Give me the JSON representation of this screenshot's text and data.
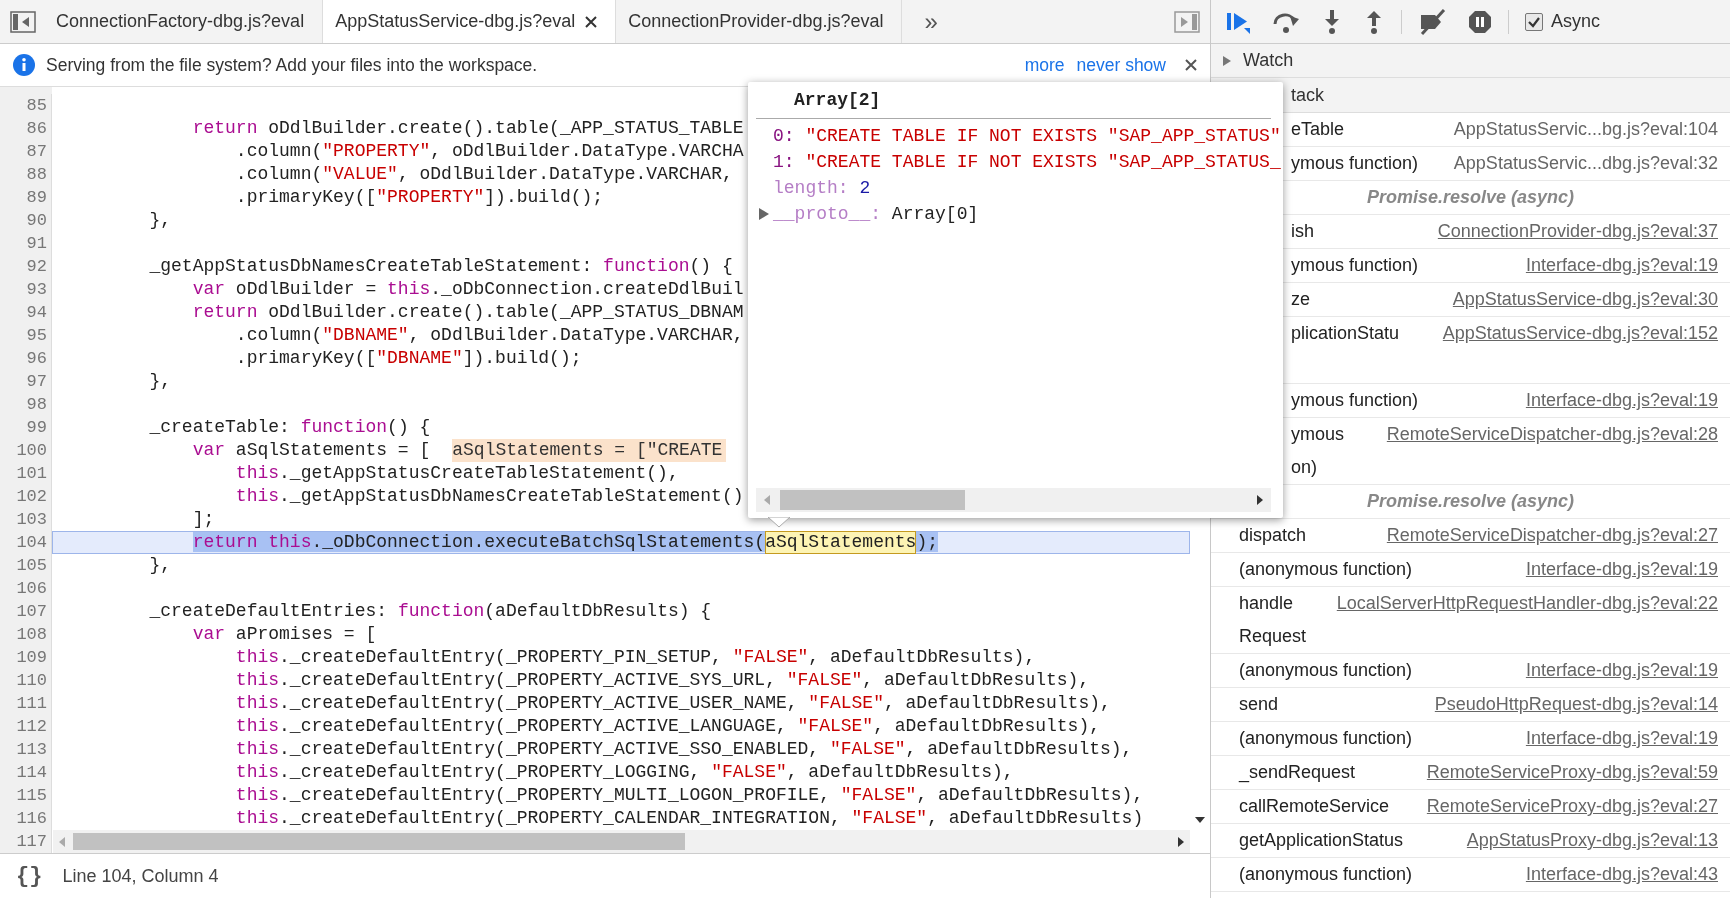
{
  "tabs": [
    {
      "label": "ConnectionFactory-dbg.js?eval",
      "selected": false
    },
    {
      "label": "AppStatusService-dbg.js?eval",
      "selected": true
    },
    {
      "label": "ConnectionProvider-dbg.js?eval",
      "selected": false
    }
  ],
  "tab_overflow": "»",
  "infobar": {
    "message": "Serving from the file system? Add your files into the workspace.",
    "links": [
      "more",
      "never show"
    ]
  },
  "code": {
    "lines": [
      {
        "number": "85",
        "current": false
      },
      {
        "number": "86",
        "current": false,
        "tokens": [
          {
            "text": "            return",
            "kind": "keyword"
          },
          {
            "text": " oDdlBuilder.create().table(_APP_STATUS_TABLE",
            "kind": "plain"
          }
        ]
      },
      {
        "number": "87",
        "current": false,
        "tokens": [
          {
            "text": "                .column(",
            "kind": "plain"
          },
          {
            "text": "\"PROPERTY\"",
            "kind": "string"
          },
          {
            "text": ", oDdlBuilder.DataType.VARCHA",
            "kind": "plain"
          }
        ]
      },
      {
        "number": "88",
        "current": false,
        "tokens": [
          {
            "text": "                .column(",
            "kind": "plain"
          },
          {
            "text": "\"VALUE\"",
            "kind": "string"
          },
          {
            "text": ", oDdlBuilder.DataType.VARCHAR,",
            "kind": "plain"
          }
        ]
      },
      {
        "number": "89",
        "current": false,
        "tokens": [
          {
            "text": "                .primaryKey([",
            "kind": "plain"
          },
          {
            "text": "\"PROPERTY\"",
            "kind": "string"
          },
          {
            "text": "]).build();",
            "kind": "plain"
          }
        ]
      },
      {
        "number": "90",
        "current": false,
        "tokens": [
          {
            "text": "        },",
            "kind": "plain"
          }
        ]
      },
      {
        "number": "91",
        "current": false
      },
      {
        "number": "92",
        "current": false,
        "tokens": [
          {
            "text": "        _getAppStatusDbNamesCreateTableStatement: ",
            "kind": "plain"
          },
          {
            "text": "function",
            "kind": "keyword"
          },
          {
            "text": "() {",
            "kind": "plain"
          }
        ]
      },
      {
        "number": "93",
        "current": false,
        "tokens": [
          {
            "text": "            var",
            "kind": "keyword"
          },
          {
            "text": " oDdlBuilder = ",
            "kind": "plain"
          },
          {
            "text": "this",
            "kind": "keyword"
          },
          {
            "text": "._oDbConnection.createDdlBuil",
            "kind": "plain"
          }
        ]
      },
      {
        "number": "94",
        "current": false,
        "tokens": [
          {
            "text": "            return",
            "kind": "keyword"
          },
          {
            "text": " oDdlBuilder.create().table(_APP_STATUS_DBNAM",
            "kind": "plain"
          }
        ]
      },
      {
        "number": "95",
        "current": false,
        "tokens": [
          {
            "text": "                .column(",
            "kind": "plain"
          },
          {
            "text": "\"DBNAME\"",
            "kind": "string"
          },
          {
            "text": ", oDdlBuilder.DataType.VARCHAR,",
            "kind": "plain"
          }
        ]
      },
      {
        "number": "96",
        "current": false,
        "tokens": [
          {
            "text": "                .primaryKey([",
            "kind": "plain"
          },
          {
            "text": "\"DBNAME\"",
            "kind": "string"
          },
          {
            "text": "]).build();",
            "kind": "plain"
          }
        ]
      },
      {
        "number": "97",
        "current": false,
        "tokens": [
          {
            "text": "        },",
            "kind": "plain"
          }
        ]
      },
      {
        "number": "98",
        "current": false
      },
      {
        "number": "99",
        "current": false,
        "tokens": [
          {
            "text": "        _createTable: ",
            "kind": "plain"
          },
          {
            "text": "function",
            "kind": "keyword"
          },
          {
            "text": "() {",
            "kind": "plain"
          }
        ]
      },
      {
        "number": "100",
        "current": false,
        "tokens": [
          {
            "text": "            var",
            "kind": "keyword"
          },
          {
            "text": " aSqlStatements = [",
            "kind": "plain"
          },
          {
            "text": "aSqlStatements = [\"CREATE",
            "kind": "inline-value"
          }
        ]
      },
      {
        "number": "101",
        "current": false,
        "tokens": [
          {
            "text": "                this",
            "kind": "keyword"
          },
          {
            "text": "._getAppStatusCreateTableStatement(),",
            "kind": "plain"
          }
        ]
      },
      {
        "number": "102",
        "current": false,
        "tokens": [
          {
            "text": "                this",
            "kind": "keyword"
          },
          {
            "text": "._getAppStatusDbNamesCreateTableStatement()",
            "kind": "plain"
          }
        ]
      },
      {
        "number": "103",
        "current": false,
        "tokens": [
          {
            "text": "            ];",
            "kind": "plain"
          }
        ]
      },
      {
        "number": "104",
        "current": true,
        "tokens": [
          {
            "text": "            return",
            "kind": "keyword"
          },
          {
            "text": " this",
            "kind": "keyword"
          },
          {
            "text": "._oDbConnection.executeBatchSqlStatements(",
            "kind": "plain"
          },
          {
            "text": "aSqlStatements",
            "kind": "hover-value"
          },
          {
            "text": ");",
            "kind": "plain"
          }
        ]
      },
      {
        "number": "105",
        "current": false,
        "tokens": [
          {
            "text": "        },",
            "kind": "plain"
          }
        ]
      },
      {
        "number": "106",
        "current": false
      },
      {
        "number": "107",
        "current": false,
        "tokens": [
          {
            "text": "        _createDefaultEntries: ",
            "kind": "plain"
          },
          {
            "text": "function",
            "kind": "keyword"
          },
          {
            "text": "(aDefaultDbResults) {",
            "kind": "plain"
          }
        ]
      },
      {
        "number": "108",
        "current": false,
        "tokens": [
          {
            "text": "            var",
            "kind": "keyword"
          },
          {
            "text": " aPromises = [",
            "kind": "plain"
          }
        ]
      },
      {
        "number": "109",
        "current": false,
        "tokens": [
          {
            "text": "                this",
            "kind": "keyword"
          },
          {
            "text": "._createDefaultEntry(_PROPERTY_PIN_SETUP, ",
            "kind": "plain"
          },
          {
            "text": "\"FALSE\"",
            "kind": "string"
          },
          {
            "text": ", aDefaultDbResults),",
            "kind": "plain"
          }
        ]
      },
      {
        "number": "110",
        "current": false,
        "tokens": [
          {
            "text": "                this",
            "kind": "keyword"
          },
          {
            "text": "._createDefaultEntry(_PROPERTY_ACTIVE_SYS_URL, ",
            "kind": "plain"
          },
          {
            "text": "\"FALSE\"",
            "kind": "string"
          },
          {
            "text": ", aDefaultDbResults),",
            "kind": "plain"
          }
        ]
      },
      {
        "number": "111",
        "current": false,
        "tokens": [
          {
            "text": "                this",
            "kind": "keyword"
          },
          {
            "text": "._createDefaultEntry(_PROPERTY_ACTIVE_USER_NAME, ",
            "kind": "plain"
          },
          {
            "text": "\"FALSE\"",
            "kind": "string"
          },
          {
            "text": ", aDefaultDbResults),",
            "kind": "plain"
          }
        ]
      },
      {
        "number": "112",
        "current": false,
        "tokens": [
          {
            "text": "                this",
            "kind": "keyword"
          },
          {
            "text": "._createDefaultEntry(_PROPERTY_ACTIVE_LANGUAGE, ",
            "kind": "plain"
          },
          {
            "text": "\"FALSE\"",
            "kind": "string"
          },
          {
            "text": ", aDefaultDbResults),",
            "kind": "plain"
          }
        ]
      },
      {
        "number": "113",
        "current": false,
        "tokens": [
          {
            "text": "                this",
            "kind": "keyword"
          },
          {
            "text": "._createDefaultEntry(_PROPERTY_ACTIVE_SSO_ENABLED, ",
            "kind": "plain"
          },
          {
            "text": "\"FALSE\"",
            "kind": "string"
          },
          {
            "text": ", aDefaultDbResults),",
            "kind": "plain"
          }
        ]
      },
      {
        "number": "114",
        "current": false,
        "tokens": [
          {
            "text": "                this",
            "kind": "keyword"
          },
          {
            "text": "._createDefaultEntry(_PROPERTY_LOGGING, ",
            "kind": "plain"
          },
          {
            "text": "\"FALSE\"",
            "kind": "string"
          },
          {
            "text": ", aDefaultDbResults),",
            "kind": "plain"
          }
        ]
      },
      {
        "number": "115",
        "current": false,
        "tokens": [
          {
            "text": "                this",
            "kind": "keyword"
          },
          {
            "text": "._createDefaultEntry(_PROPERTY_MULTI_LOGON_PROFILE, ",
            "kind": "plain"
          },
          {
            "text": "\"FALSE\"",
            "kind": "string"
          },
          {
            "text": ", aDefaultDbResults),",
            "kind": "plain"
          }
        ]
      },
      {
        "number": "116",
        "current": false,
        "tokens": [
          {
            "text": "                this",
            "kind": "keyword"
          },
          {
            "text": "._createDefaultEntry(_PROPERTY_CALENDAR_INTEGRATION, ",
            "kind": "plain"
          },
          {
            "text": "\"FALSE\"",
            "kind": "string"
          },
          {
            "text": ", aDefaultDbResults)",
            "kind": "plain"
          }
        ]
      },
      {
        "number": "117",
        "current": false
      }
    ]
  },
  "popover": {
    "title": "Array[2]",
    "properties": [
      {
        "key": "0:",
        "value": "\"CREATE TABLE IF NOT EXISTS \"SAP_APP_STATUS\"",
        "kind": "string",
        "enumerable": true
      },
      {
        "key": "1:",
        "value": "\"CREATE TABLE IF NOT EXISTS \"SAP_APP_STATUS_",
        "kind": "string",
        "enumerable": true
      },
      {
        "key": "length:",
        "value": "2",
        "kind": "number",
        "enumerable": false
      },
      {
        "key": "__proto__:",
        "value": "Array[0]",
        "kind": "object",
        "enumerable": false
      }
    ]
  },
  "status_bar": {
    "format_button": "{}",
    "position": "Line 104, Column 4"
  },
  "debugger": {
    "async": {
      "label": "Async",
      "checked": true
    },
    "watch": {
      "title": "Watch",
      "expanded": false
    },
    "call_stack": {
      "title": "tack",
      "frames": [
        {
          "kind": "frame",
          "name": [
            "eTable"
          ],
          "location": "AppStatusServic...bg.js?eval:104",
          "linked": false
        },
        {
          "kind": "frame",
          "name": [
            "ymous function)"
          ],
          "location": "AppStatusServic...dbg.js?eval:32",
          "linked": false
        },
        {
          "kind": "async",
          "name": [
            "Promise.resolve (async)"
          ]
        },
        {
          "kind": "frame",
          "name": [
            "ish"
          ],
          "location": "ConnectionProvider-dbg.js?eval:37",
          "linked": true
        },
        {
          "kind": "frame",
          "name": [
            "ymous function)"
          ],
          "location": "Interface-dbg.js?eval:19",
          "linked": true
        },
        {
          "kind": "frame",
          "name": [
            "ze"
          ],
          "location": "AppStatusService-dbg.js?eval:30",
          "linked": true
        },
        {
          "kind": "frame",
          "name": [
            "plicationStatu"
          ],
          "location": "AppStatusService-dbg.js?eval:152",
          "linked": true
        },
        {
          "kind": "frame",
          "name": [
            "ymous function)"
          ],
          "location": "Interface-dbg.js?eval:19",
          "linked": true
        },
        {
          "kind": "frame",
          "name": [
            "ymous",
            "on)"
          ],
          "location": "RemoteServiceDispatcher-dbg.js?eval:28",
          "linked": true
        },
        {
          "kind": "async",
          "name": [
            "Promise.resolve (async)"
          ]
        },
        {
          "kind": "frame",
          "name": [
            "dispatch"
          ],
          "location": "RemoteServiceDispatcher-dbg.js?eval:27",
          "linked": true
        },
        {
          "kind": "frame",
          "name": [
            "(anonymous function)"
          ],
          "location": "Interface-dbg.js?eval:19",
          "linked": true
        },
        {
          "kind": "frame",
          "name": [
            "handle",
            "Request"
          ],
          "location": "LocalServerHttpRequestHandler-dbg.js?eval:22",
          "linked": true
        },
        {
          "kind": "frame",
          "name": [
            "(anonymous function)"
          ],
          "location": "Interface-dbg.js?eval:19",
          "linked": true
        },
        {
          "kind": "frame",
          "name": [
            "send"
          ],
          "location": "PseudoHttpRequest-dbg.js?eval:14",
          "linked": true
        },
        {
          "kind": "frame",
          "name": [
            "(anonymous function)"
          ],
          "location": "Interface-dbg.js?eval:19",
          "linked": true
        },
        {
          "kind": "frame",
          "name": [
            "_sendRequest"
          ],
          "location": "RemoteServiceProxy-dbg.js?eval:59",
          "linked": true
        },
        {
          "kind": "frame",
          "name": [
            "callRemoteService"
          ],
          "location": "RemoteServiceProxy-dbg.js?eval:27",
          "linked": true
        },
        {
          "kind": "frame",
          "name": [
            "getApplicationStatus"
          ],
          "location": "AppStatusProxy-dbg.js?eval:13",
          "linked": true
        },
        {
          "kind": "frame",
          "name": [
            "(anonymous function)"
          ],
          "location": "Interface-dbg.js?eval:43",
          "linked": true
        }
      ]
    }
  }
}
